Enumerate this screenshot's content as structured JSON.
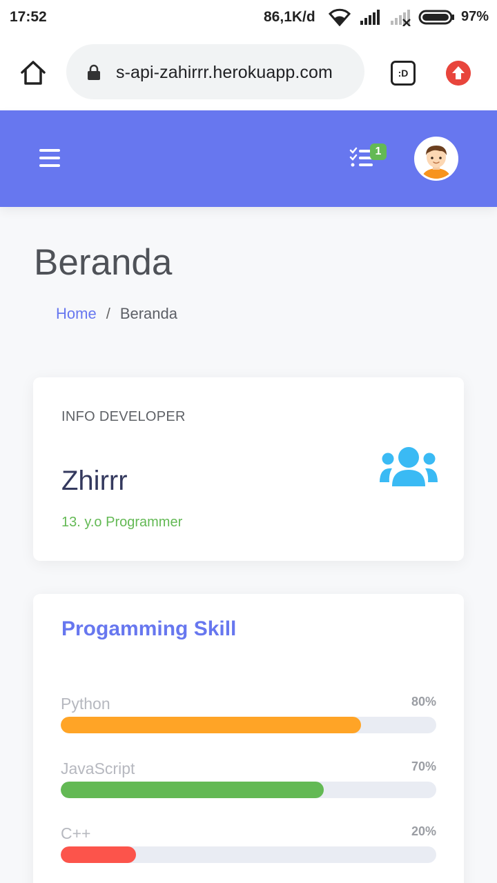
{
  "status": {
    "time": "17:52",
    "network_speed": "86,1K/d",
    "battery": "97%"
  },
  "browser": {
    "url": "s-api-zahirrr.herokuapp.com",
    "tabs_label": ":D"
  },
  "header": {
    "tasks_badge": "1"
  },
  "page": {
    "title": "Beranda",
    "breadcrumb": {
      "home": "Home",
      "separator": "/",
      "current": "Beranda"
    }
  },
  "info_card": {
    "label": "INFO DEVELOPER",
    "name": "Zhirrr",
    "subtitle": "13. y.o Programmer"
  },
  "skills_card": {
    "title": "Progamming Skill",
    "skills": [
      {
        "name": "Python",
        "percent_label": "80%",
        "value": 80,
        "color": "#ffa426"
      },
      {
        "name": "JavaScript",
        "percent_label": "70%",
        "value": 70,
        "color": "#63b954"
      },
      {
        "name": "C++",
        "percent_label": "20%",
        "value": 20,
        "color": "#fc544b"
      }
    ]
  },
  "colors": {
    "primary": "#6777ef",
    "success": "#63b954",
    "warning": "#ffa426",
    "danger": "#fc544b",
    "info": "#3abaf4"
  },
  "icons": {
    "status": [
      "wifi-icon",
      "signal-icon",
      "no-signal-icon",
      "battery-icon"
    ],
    "browser": [
      "home-icon",
      "lock-icon",
      "tabs-icon",
      "upload-icon"
    ],
    "header": [
      "menu-icon",
      "tasks-icon",
      "avatar"
    ],
    "info": [
      "users-icon"
    ]
  }
}
